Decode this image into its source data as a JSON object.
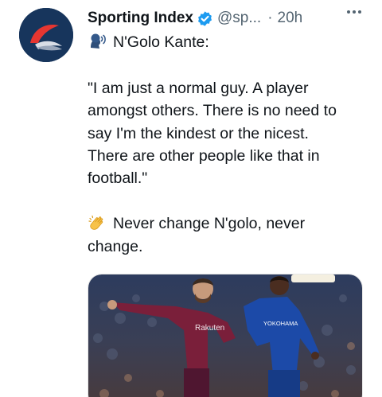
{
  "account": {
    "name": "Sporting Index",
    "handle": "@sp...",
    "separator": "·",
    "time": "20h",
    "verified": true,
    "avatar_icon": "sporting-index-logo"
  },
  "tweet": {
    "intro_icon": "speaking-head-emoji",
    "intro": "N'Golo Kante:",
    "quote_lines": [
      "\"I am just a normal guy. A player",
      "amongst others. There is no need to",
      "say I'm the kindest or the nicest.",
      "There are other people like that in",
      "football.\""
    ],
    "outro_icon": "clapping-hands-emoji",
    "outro_lines": [
      "Never change N'golo, never",
      "change."
    ]
  },
  "media": {
    "kind": "photo",
    "left_shirt_text": "Rakuten",
    "right_shirt_text": "YOKOHAMA"
  },
  "colors": {
    "verified": "#1d9bf0",
    "secondary_text": "#536471",
    "barca_shirt": "#7a1f3a",
    "chelsea_shirt": "#1c4aa8"
  }
}
